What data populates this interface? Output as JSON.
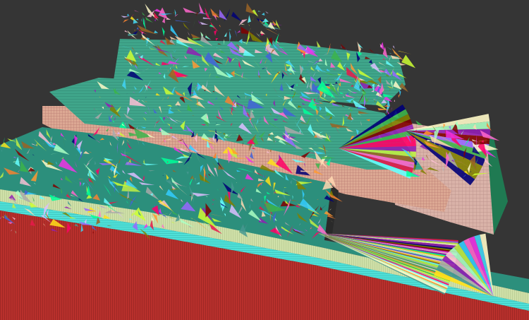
{
  "viewport": {
    "background": "#353535",
    "render_mode": "triangle-id-colors"
  },
  "model": {
    "palette": [
      "#e6194b",
      "#3cb44b",
      "#ffe119",
      "#4363d8",
      "#f58231",
      "#911eb4",
      "#42d4f4",
      "#f032e6",
      "#bfef45",
      "#fabed4",
      "#469990",
      "#dcbeff",
      "#9a6324",
      "#fffac8",
      "#800000",
      "#aaffc3",
      "#808000",
      "#ffd8b1",
      "#000075",
      "#a9a9a9",
      "#00ff99",
      "#ff0066",
      "#66ffff",
      "#9966ff",
      "#ccff33",
      "#ff9933",
      "#33ccff",
      "#ff66cc"
    ],
    "colors": {
      "lower_wall_red": "#b8302c",
      "lower_rim_cyan": "#4fe0d8",
      "lower_wall_pale": "#cfe0a8",
      "main_wall_peach": "#dca893",
      "right_wall_pink": "#d9b2a8",
      "teal_roof": "#3fa58a",
      "green_edge": "#1f7a52"
    }
  }
}
